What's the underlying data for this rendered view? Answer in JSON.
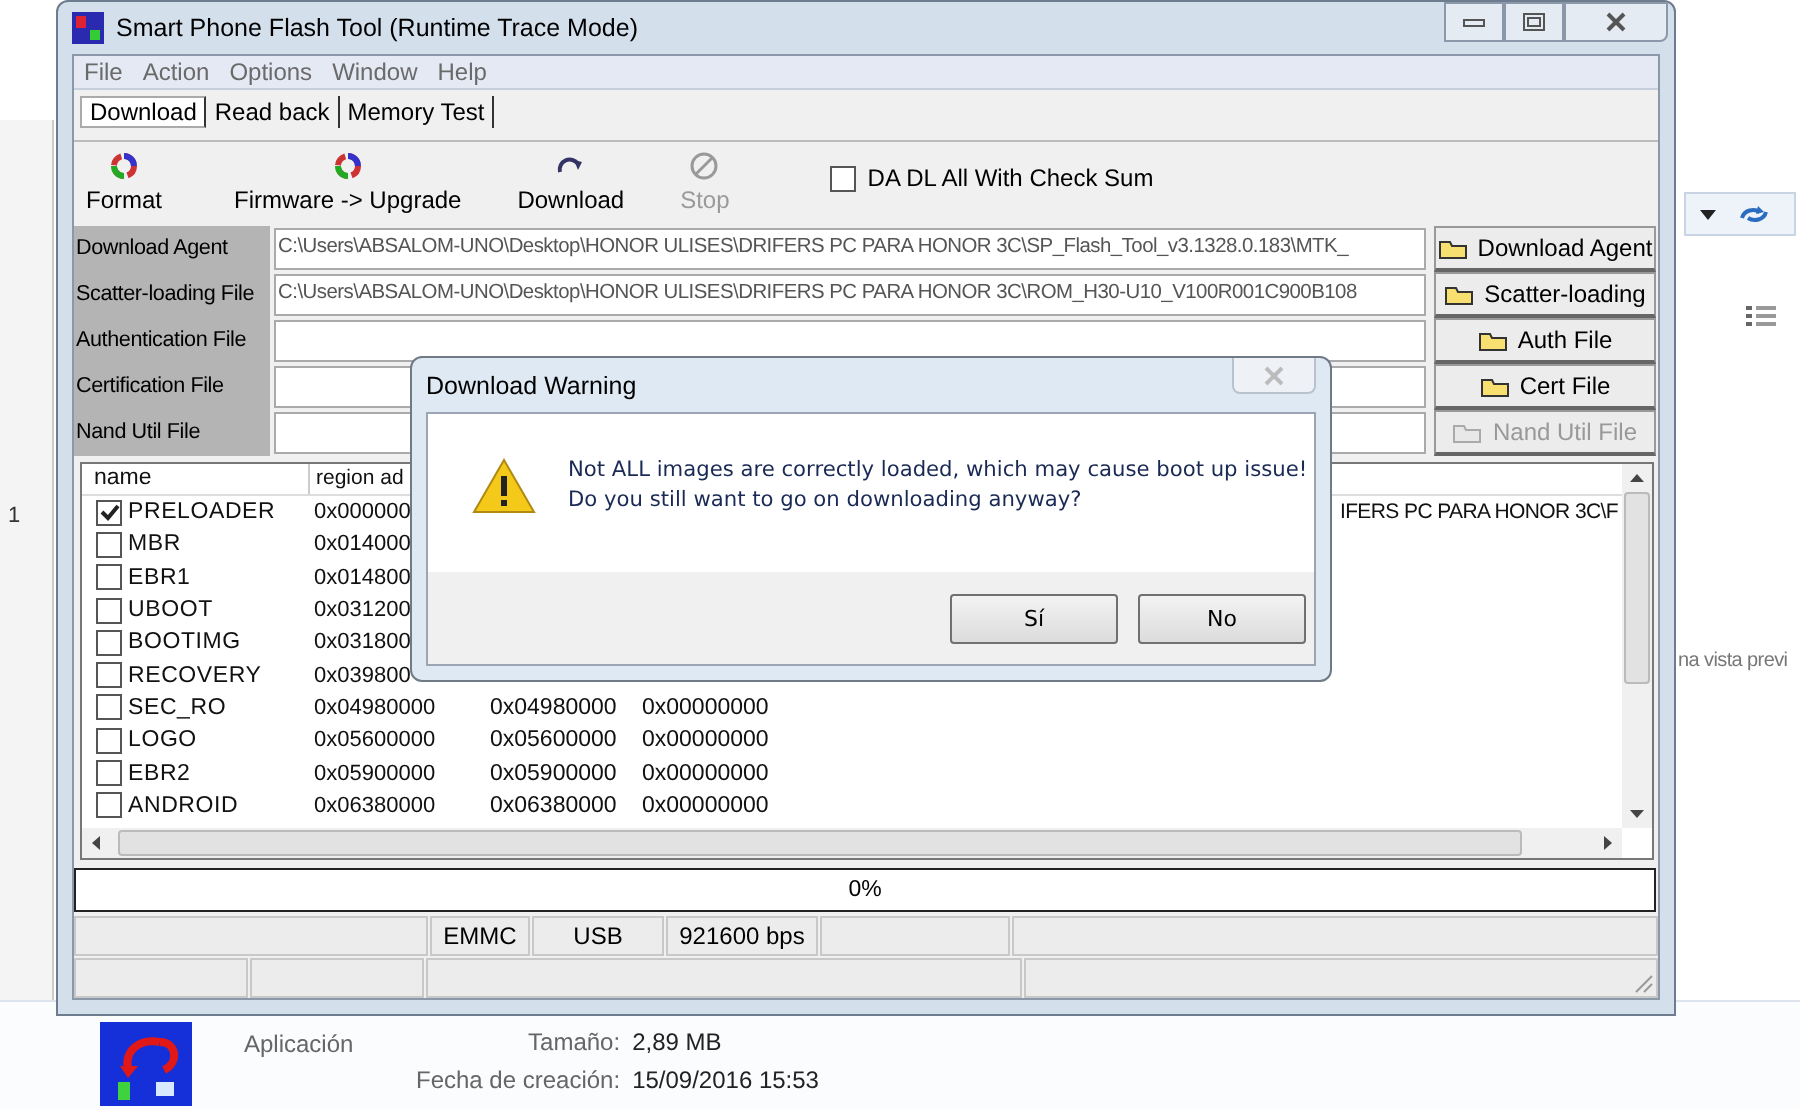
{
  "main_window": {
    "title": "Smart Phone Flash Tool (Runtime Trace Mode)",
    "menu": [
      "File",
      "Action",
      "Options",
      "Window",
      "Help"
    ],
    "tabs": [
      {
        "label": "Download",
        "selected": true
      },
      {
        "label": "Read back",
        "selected": false
      },
      {
        "label": "Memory Test",
        "selected": false
      }
    ],
    "toolbar": [
      {
        "kind": "format",
        "label": "Format",
        "disabled": false
      },
      {
        "kind": "upgrade",
        "label": "Firmware -> Upgrade",
        "disabled": false
      },
      {
        "kind": "download",
        "label": "Download",
        "disabled": false
      },
      {
        "kind": "stop",
        "label": "Stop",
        "disabled": true
      }
    ],
    "checksum_option": {
      "label": "DA DL All With Check Sum",
      "checked": false
    },
    "file_fields": [
      {
        "label": "Download Agent",
        "value": "C:\\Users\\ABSALOM-UNO\\Desktop\\HONOR ULISES\\DRIFERS PC PARA HONOR 3C\\SP_Flash_Tool_v3.1328.0.183\\MTK_",
        "button": "Download Agent",
        "disabled": false
      },
      {
        "label": "Scatter-loading File",
        "value": "C:\\Users\\ABSALOM-UNO\\Desktop\\HONOR ULISES\\DRIFERS PC PARA HONOR 3C\\ROM_H30-U10_V100R001C900B108",
        "button": "Scatter-loading",
        "disabled": false
      },
      {
        "label": "Authentication File",
        "button": "Auth File",
        "disabled": false
      },
      {
        "label": "Certification File",
        "button": "Cert File",
        "disabled": false
      },
      {
        "label": "Nand Util File",
        "button": "Nand Util File",
        "disabled": true
      }
    ],
    "partition_table": {
      "columns": [
        "name",
        "region ad"
      ],
      "rows": [
        {
          "name": "PRELOADER",
          "checked": true,
          "column_2": "0x000000",
          "column_5": "IFERS PC PARA HONOR 3C\\F"
        },
        {
          "name": "MBR",
          "checked": false,
          "column_2": "0x014000"
        },
        {
          "name": "EBR1",
          "checked": false,
          "column_2": "0x014800"
        },
        {
          "name": "UBOOT",
          "checked": false,
          "column_2": "0x031200"
        },
        {
          "name": "BOOTIMG",
          "checked": false,
          "column_2": "0x031800"
        },
        {
          "name": "RECOVERY",
          "checked": false,
          "column_2": "0x039800"
        },
        {
          "name": "SEC_RO",
          "checked": false,
          "column_2": "0x04980000",
          "column_3": "0x04980000",
          "column_4": "0x00000000"
        },
        {
          "name": "LOGO",
          "checked": false,
          "column_2": "0x05600000",
          "column_3": "0x05600000",
          "column_4": "0x00000000"
        },
        {
          "name": "EBR2",
          "checked": false,
          "column_2": "0x05900000",
          "column_3": "0x05900000",
          "column_4": "0x00000000"
        },
        {
          "name": "ANDROID",
          "checked": false,
          "column_2": "0x06380000",
          "column_3": "0x06380000",
          "column_4": "0x00000000"
        }
      ]
    },
    "progress": {
      "text": "0%",
      "level": 0
    },
    "status_bar": [
      "EMMC",
      "USB",
      "921600 bps"
    ]
  },
  "dialog": {
    "title": "Download Warning",
    "message": [
      "Not ALL images are correctly loaded, which may cause boot up issue!",
      "Do you still want to go on downloading anyway?"
    ],
    "buttons": [
      "Sí",
      "No"
    ]
  },
  "background": {
    "list_number": "1",
    "preview_hint": "na vista previ",
    "file_type": "Aplicación",
    "details": [
      {
        "label": "Tamaño:",
        "value": "2,89 MB"
      },
      {
        "label": "Fecha de creación:",
        "value": "15/09/2016 15:53"
      }
    ]
  }
}
